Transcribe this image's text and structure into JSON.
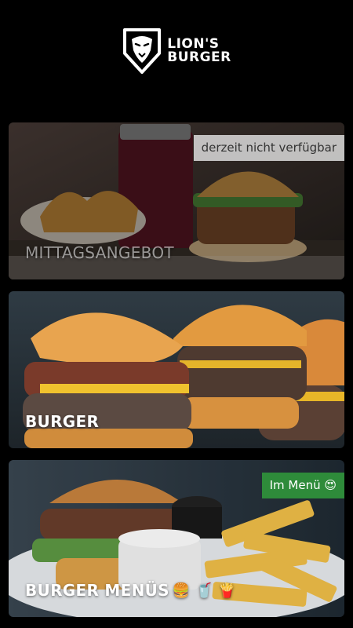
{
  "brand": {
    "line1": "LION'S",
    "line2": "BURGER"
  },
  "cards": [
    {
      "title": "MITTAGSANGEBOT",
      "badge": "derzeit nicht verfügbar"
    },
    {
      "title": "BURGER"
    },
    {
      "title": "BURGER MENÜS",
      "title_emojis": "🍔 🥤 🍟",
      "badge": "Im Menü 😍"
    }
  ],
  "colors": {
    "background": "#000000",
    "badge_green": "#2e8b3a",
    "badge_gray": "#dcdcdc"
  },
  "icons": {
    "logo": "lion-head-icon"
  }
}
